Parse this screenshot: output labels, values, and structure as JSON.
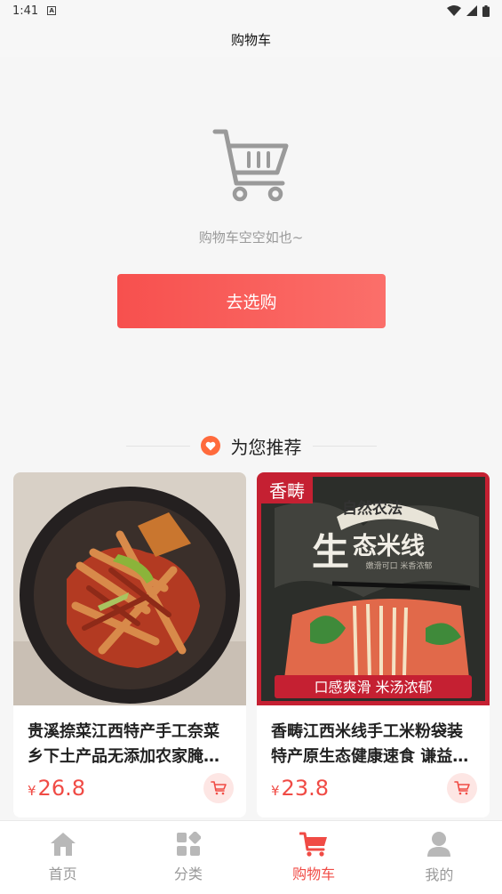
{
  "status": {
    "time": "1:41",
    "notif_letter": "A"
  },
  "header": {
    "title": "购物车"
  },
  "empty": {
    "message": "购物车空空如也~",
    "button": "去选购"
  },
  "recommend": {
    "title": "为您推荐"
  },
  "products": [
    {
      "name": "贵溪捺菜江西特产手工奈菜乡下土产品无添加农家腌…",
      "currency": "¥",
      "price": "26.8"
    },
    {
      "name": "香畴江西米线手工米粉袋装特产原生态健康速食 谦益…",
      "currency": "¥",
      "price": "23.8",
      "image_text": {
        "brand": "香畴",
        "top": "自然农法",
        "big": "生",
        "rest": "态米线",
        "small": "嫩滑可口 米香浓郁",
        "banner": "口感爽滑 米汤浓郁"
      }
    }
  ],
  "tabs": [
    {
      "label": "首页",
      "icon": "home-icon"
    },
    {
      "label": "分类",
      "icon": "category-icon"
    },
    {
      "label": "购物车",
      "icon": "cart-icon",
      "active": true
    },
    {
      "label": "我的",
      "icon": "user-icon"
    }
  ],
  "colors": {
    "accent": "#f04b45",
    "button": "#f7504e",
    "heart": "#ff6a3c"
  }
}
